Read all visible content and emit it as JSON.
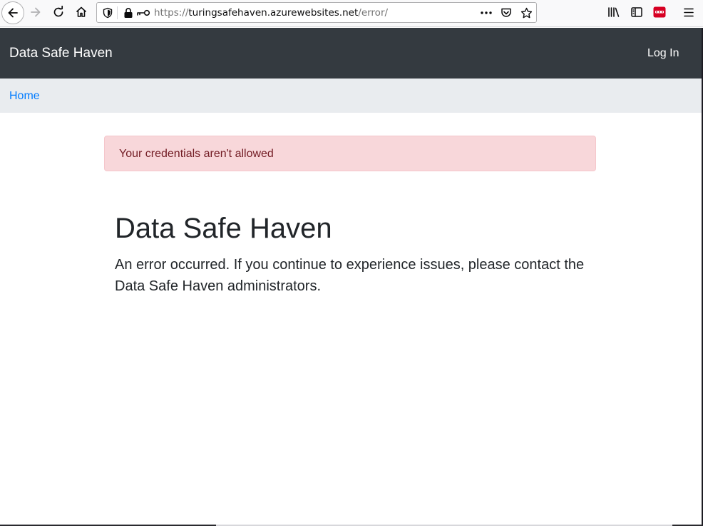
{
  "browser": {
    "url_scheme": "https://",
    "url_host": "turingsafehaven.azurewebsites.net",
    "url_path": "/error/",
    "icons": [
      "back-arrow-icon",
      "forward-arrow-icon",
      "reload-icon",
      "home-icon",
      "shield-icon",
      "lock-icon",
      "key-icon",
      "more-dots-icon",
      "pocket-icon",
      "bookmark-star-icon",
      "library-icon",
      "sidebar-icon",
      "extension-icon",
      "hamburger-menu-icon"
    ]
  },
  "navbar": {
    "brand": "Data Safe Haven",
    "login_label": "Log In"
  },
  "breadcrumb": {
    "home_label": "Home"
  },
  "alert": {
    "message": "Your credentials aren't allowed"
  },
  "main": {
    "title": "Data Safe Haven",
    "text": "An error occurred. If you continue to experience issues, please contact the Data Safe Haven administrators."
  },
  "colors": {
    "navbar_bg": "#343a40",
    "breadcrumb_bg": "#e9ecef",
    "link": "#007bff",
    "alert_bg": "#f8d7da",
    "alert_text": "#721c24",
    "extension_red": "#d70022"
  }
}
